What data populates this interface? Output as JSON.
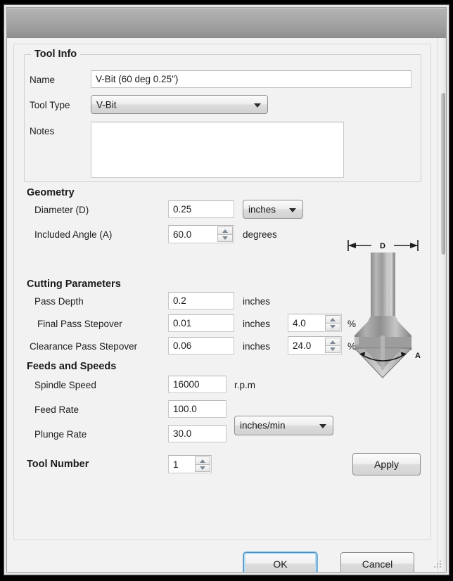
{
  "window": {
    "title": ""
  },
  "tool_info": {
    "group_title": "Tool Info",
    "name_label": "Name",
    "name_value": "V-Bit (60 deg 0.25\")",
    "name_placeholder": "Tool name",
    "tool_type_label": "Tool Type",
    "tool_type_value": "V-Bit",
    "tool_type_options": [
      "V-Bit"
    ],
    "notes_label": "Notes",
    "notes_value": "",
    "notes_placeholder": ""
  },
  "geometry": {
    "section_title": "Geometry",
    "diameter_label": "Diameter (D)",
    "diameter_value": "0.25",
    "diameter_units_value": "inches",
    "diameter_units_options": [
      "inches"
    ],
    "angle_label": "Included Angle (A)",
    "angle_value": "60.0",
    "angle_units": "degrees"
  },
  "cutting": {
    "section_title": "Cutting Parameters",
    "pass_depth_label": "Pass Depth",
    "pass_depth_value": "0.2",
    "pass_depth_units": "inches",
    "final_stepover_label": "Final Pass Stepover",
    "final_stepover_value": "0.01",
    "final_stepover_units": "inches",
    "final_stepover_pct": "4.0",
    "final_stepover_pct_units": "%",
    "clearance_stepover_label": "Clearance Pass Stepover",
    "clearance_stepover_value": "0.06",
    "clearance_stepover_units": "inches",
    "clearance_stepover_pct": "24.0",
    "clearance_stepover_pct_units": "%"
  },
  "feeds": {
    "section_title": "Feeds and Speeds",
    "spindle_label": "Spindle Speed",
    "spindle_value": "16000",
    "spindle_units": "r.p.m",
    "feed_rate_label": "Feed Rate",
    "feed_rate_value": "100.0",
    "plunge_rate_label": "Plunge Rate",
    "plunge_rate_value": "30.0",
    "rate_units_value": "inches/min",
    "rate_units_options": [
      "inches/min"
    ]
  },
  "tool_number": {
    "label": "Tool Number",
    "value": "1"
  },
  "buttons": {
    "apply": "Apply",
    "ok": "OK",
    "cancel": "Cancel"
  },
  "illustration": {
    "diameter_marker": "D",
    "angle_marker": "A"
  },
  "colors": {
    "accent": "#4a8fc4",
    "window_bg": "#f2f2f2",
    "titlebar": "#a8a8a8",
    "text": "#1d1d1d"
  }
}
